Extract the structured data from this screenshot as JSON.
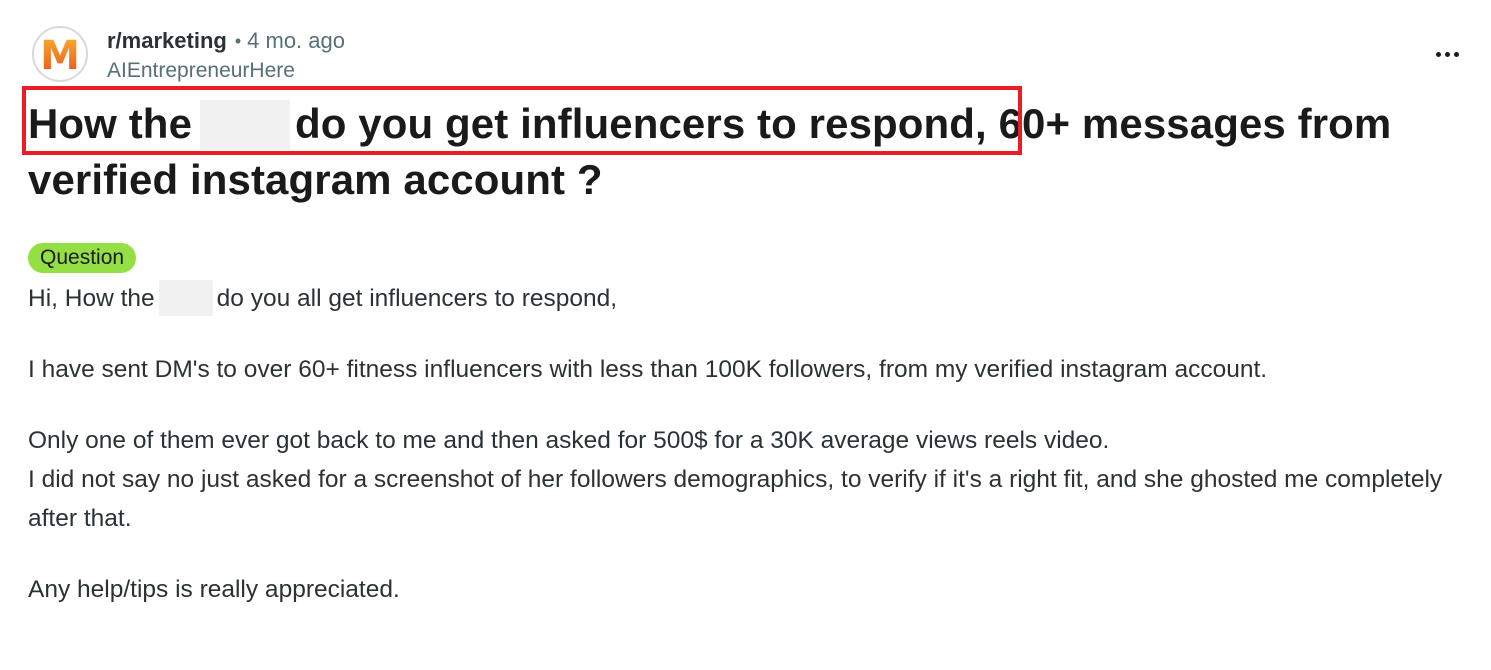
{
  "header": {
    "subreddit": "r/marketing",
    "separator": "•",
    "age": "4 mo. ago",
    "author": "AIEntrepreneurHere",
    "avatar_letter": "M",
    "more_icon": "ellipsis-horizontal-icon"
  },
  "post": {
    "title_part1": "How the",
    "title_part2": "do you get influencers to respond,",
    "title_part3": " 60+ messages from verified instagram account ?",
    "flair": "Question",
    "body_line1_part1": "Hi, How the",
    "body_line1_part2": "do you all get influencers to respond,",
    "body_paragraph2": "I have sent DM's to over 60+ fitness influencers with less than 100K followers, from my verified instagram account.",
    "body_paragraph3_line1": "Only one of them ever got back to me and then asked for 500$ for a 30K average views reels video.",
    "body_paragraph3_line2": "I did not say no just asked for a screenshot of her followers demographics, to verify if it's a right fit, and she ghosted me completely after that.",
    "body_paragraph4": "Any help/tips is really appreciated."
  },
  "colors": {
    "flair_bg": "#94e044",
    "highlight_border": "#ec1c24",
    "avatar_gradient_top": "#f9b233",
    "avatar_gradient_bottom": "#e94e1b",
    "redaction": "#f1f1f1"
  }
}
